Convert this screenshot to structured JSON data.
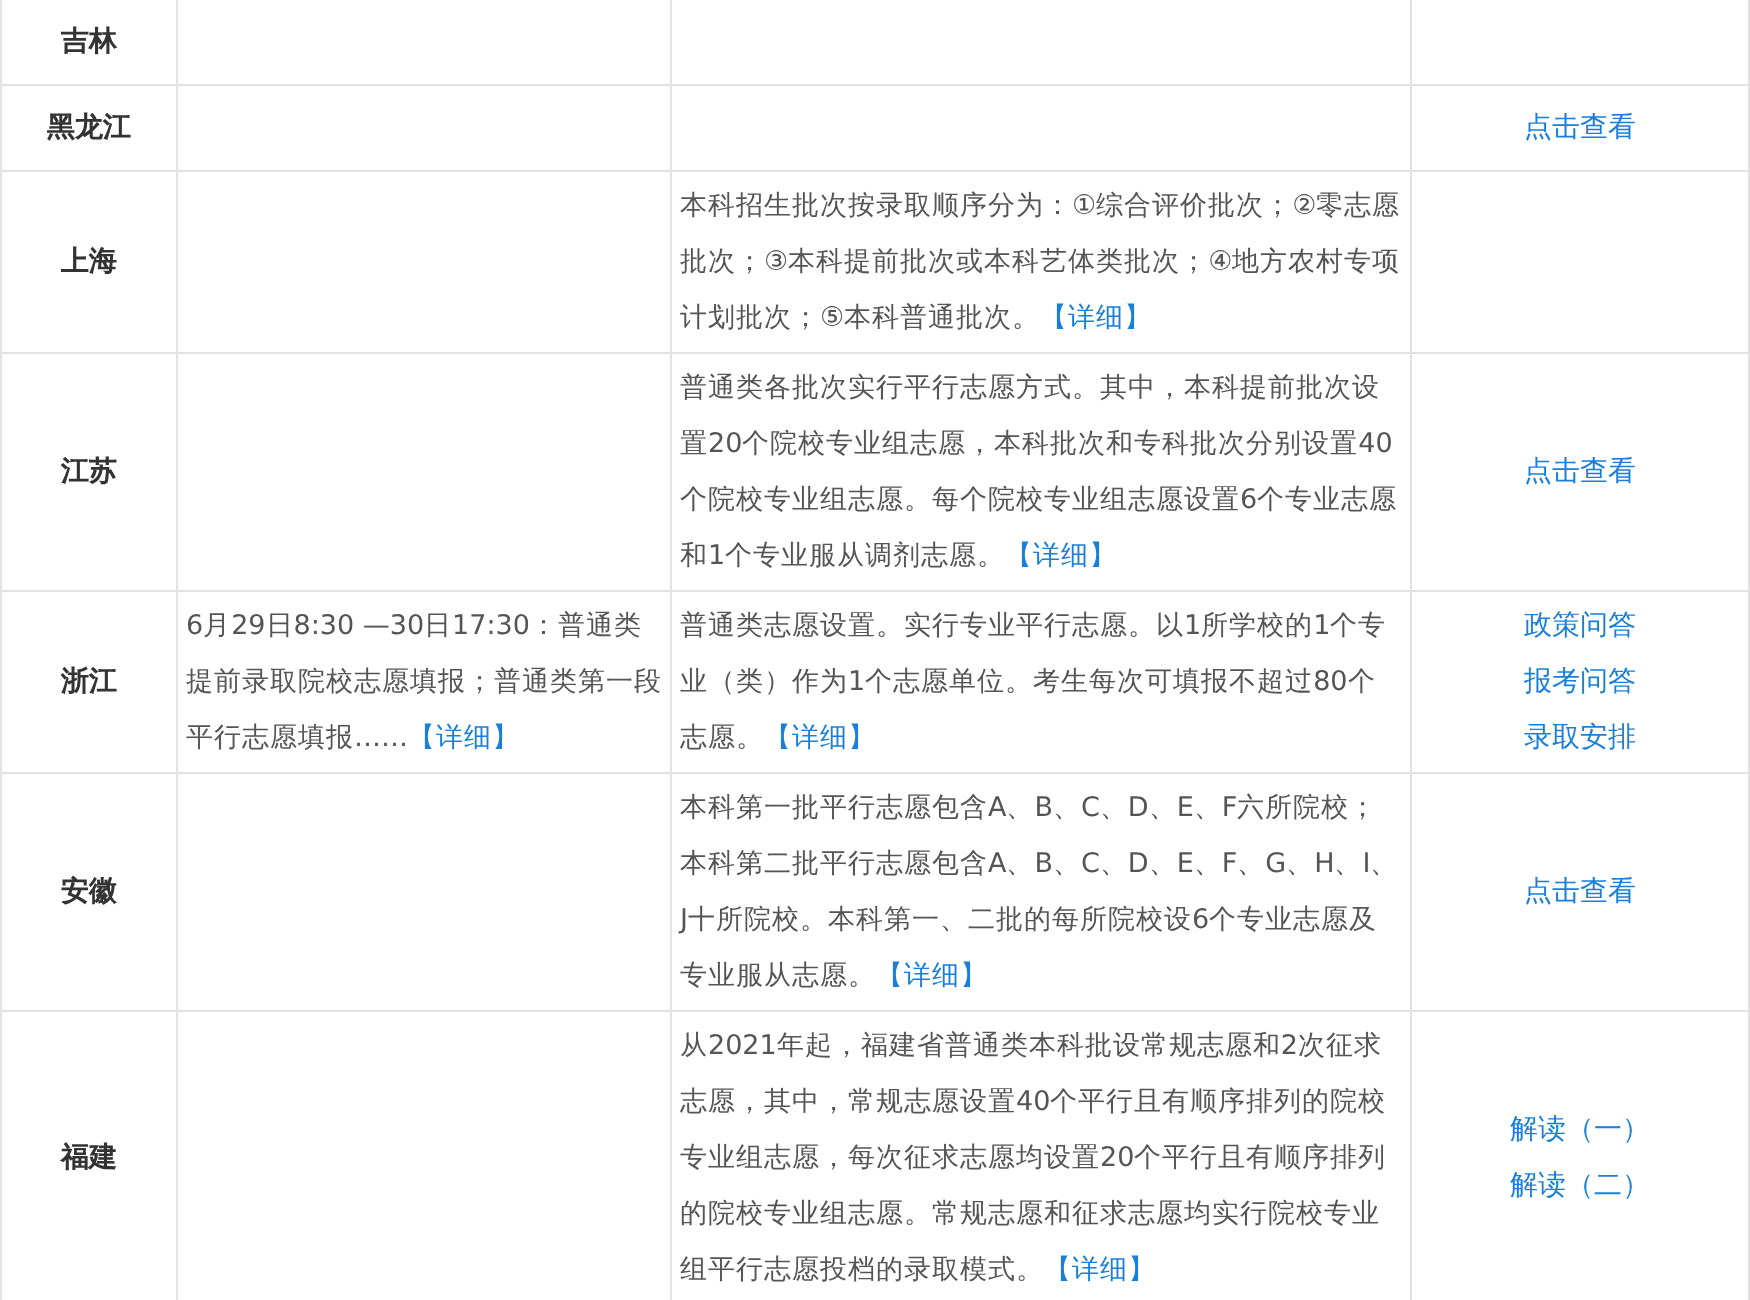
{
  "rows": [
    {
      "province": "吉林",
      "schedule": null,
      "policy": null,
      "links": []
    },
    {
      "province": "黑龙江",
      "schedule": null,
      "policy": null,
      "links": [
        "点击查看"
      ]
    },
    {
      "province": "上海",
      "schedule": null,
      "policy": {
        "text": "本科招生批次按录取顺序分为：①综合评价批次；②零志愿批次；③本科提前批次或本科艺体类批次；④地方农村专项计划批次；⑤本科普通批次。",
        "link": "【详细】"
      },
      "links": []
    },
    {
      "province": "江苏",
      "schedule": null,
      "policy": {
        "text": "普通类各批次实行平行志愿方式。其中，本科提前批次设置20个院校专业组志愿，本科批次和专科批次分别设置40个院校专业组志愿。每个院校专业组志愿设置6个专业志愿和1个专业服从调剂志愿。",
        "link": "【详细】"
      },
      "links": [
        "点击查看"
      ]
    },
    {
      "province": "浙江",
      "schedule": {
        "text": "6月29日8:30 —30日17:30：普通类提前录取院校志愿填报；普通类第一段平行志愿填报……",
        "link": "【详细】"
      },
      "policy": {
        "text": "普通类志愿设置。实行专业平行志愿。以1所学校的1个专业（类）作为1个志愿单位。考生每次可填报不超过80个志愿。",
        "link": "【详细】"
      },
      "links": [
        "政策问答",
        "报考问答",
        "录取安排"
      ]
    },
    {
      "province": "安徽",
      "schedule": null,
      "policy": {
        "text": "本科第一批平行志愿包含A、B、C、D、E、F六所院校；本科第二批平行志愿包含A、B、C、D、E、F、G、H、I、J十所院校。本科第一、二批的每所院校设6个专业志愿及专业服从志愿。",
        "link": "【详细】"
      },
      "links": [
        "点击查看"
      ]
    },
    {
      "province": "福建",
      "schedule": null,
      "policy": {
        "text": "从2021年起，福建省普通类本科批设常规志愿和2次征求志愿，其中，常规志愿设置40个平行且有顺序排列的院校专业组志愿，每次征求志愿均设置20个平行且有顺序排列的院校专业组志愿。常规志愿和征求志愿均实行院校专业组平行志愿投档的录取模式。",
        "link": "【详细】"
      },
      "links": [
        "解读（一）",
        "解读（二）"
      ]
    }
  ]
}
